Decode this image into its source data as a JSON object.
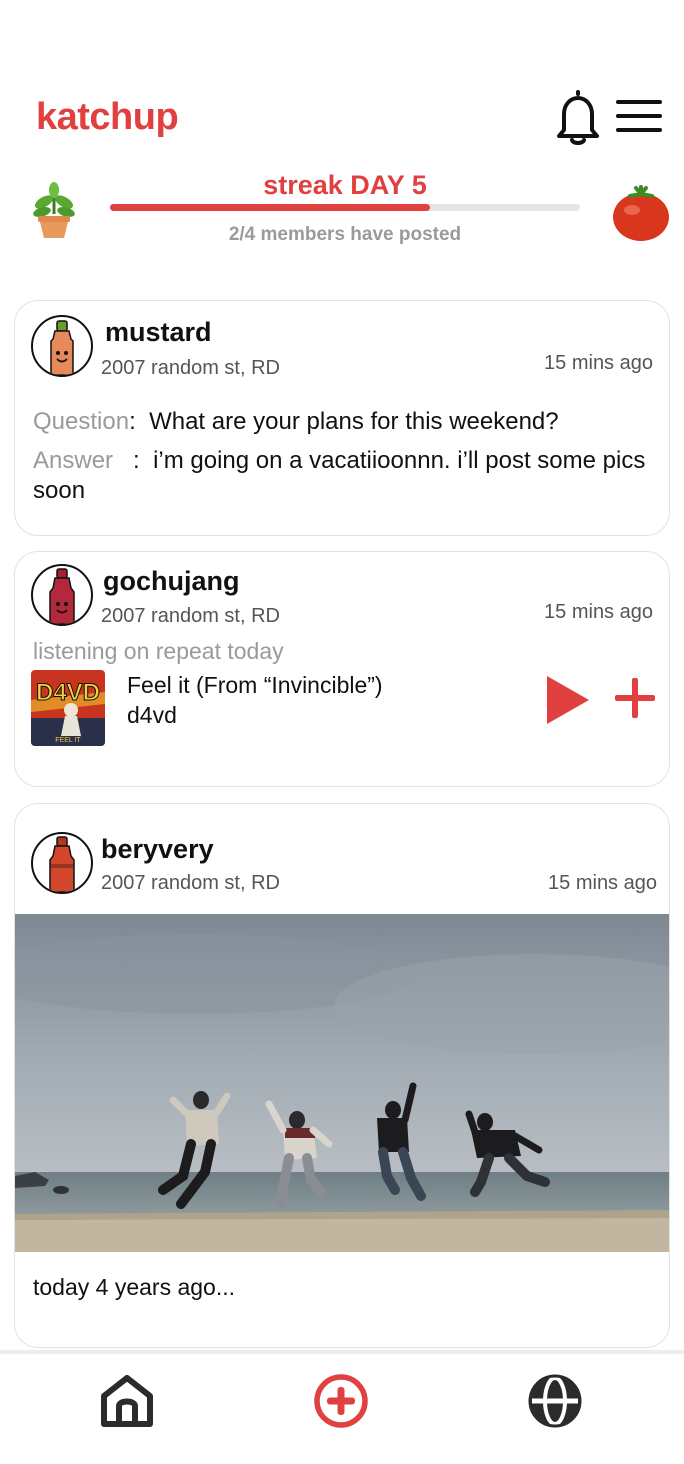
{
  "app": {
    "title": "katchup",
    "accent": "#e04040"
  },
  "header": {
    "bell_icon": "bell-icon",
    "menu_icon": "menu-icon"
  },
  "streak": {
    "title": "streak DAY 5",
    "subtitle": "2/4 members have posted",
    "progress": 0.68,
    "left_icon": "potted-plant-icon",
    "right_icon": "tomato-icon"
  },
  "posts": [
    {
      "username": "mustard",
      "address": "2007 random st, RD",
      "time": "15 mins ago",
      "avatar_color": "#e8895a",
      "type": "qa",
      "question_label": "Question",
      "question_sep": ":",
      "question": "What are your plans for this weekend?",
      "answer_label": "Answer",
      "answer_sep": ":",
      "answer": "i’m going on a vacatiioonnn. i’ll post some pics soon"
    },
    {
      "username": "gochujang",
      "address": "2007 random st, RD",
      "time": "15 mins ago",
      "avatar_color": "#b3283a",
      "type": "music",
      "caption": "listening on repeat today",
      "song_title": "Feel it (From “Invincible”)",
      "song_artist": "d4vd",
      "album_art_text": "D4VD",
      "album_art_subtext": "FEEL IT"
    },
    {
      "username": "beryvery",
      "address": "2007 random st, RD",
      "time": "15 mins ago",
      "avatar_color": "#d2462c",
      "type": "photo",
      "caption": "today 4 years ago..."
    }
  ],
  "bottom_nav": {
    "items": [
      {
        "icon": "home-icon"
      },
      {
        "icon": "add-post-icon",
        "active": true
      },
      {
        "icon": "globe-icon"
      }
    ]
  }
}
